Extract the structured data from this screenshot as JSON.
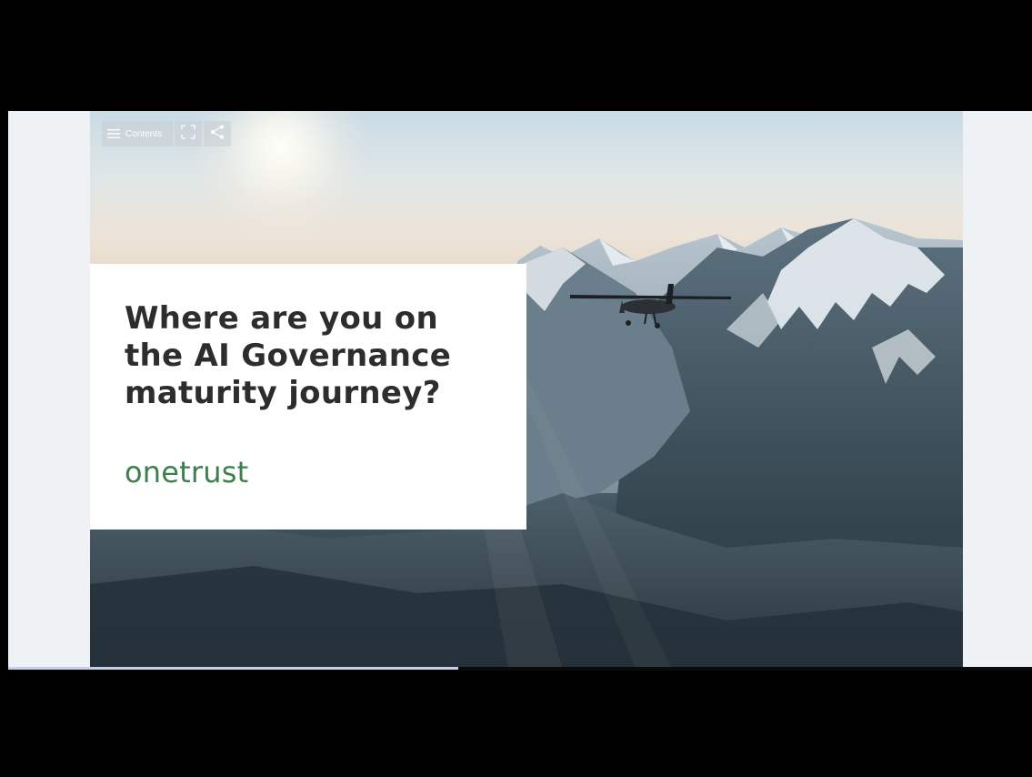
{
  "toolbar": {
    "contents_label": "Contents",
    "menu_icon": "hamburger-menu-icon",
    "fullscreen_icon": "fullscreen-icon",
    "share_icon": "share-icon"
  },
  "slide": {
    "title": "Where are you on the AI Governance maturity journey?",
    "brand": "onetrust",
    "brand_color": "#3d7f4f"
  },
  "progress": {
    "fraction": 0.44
  }
}
